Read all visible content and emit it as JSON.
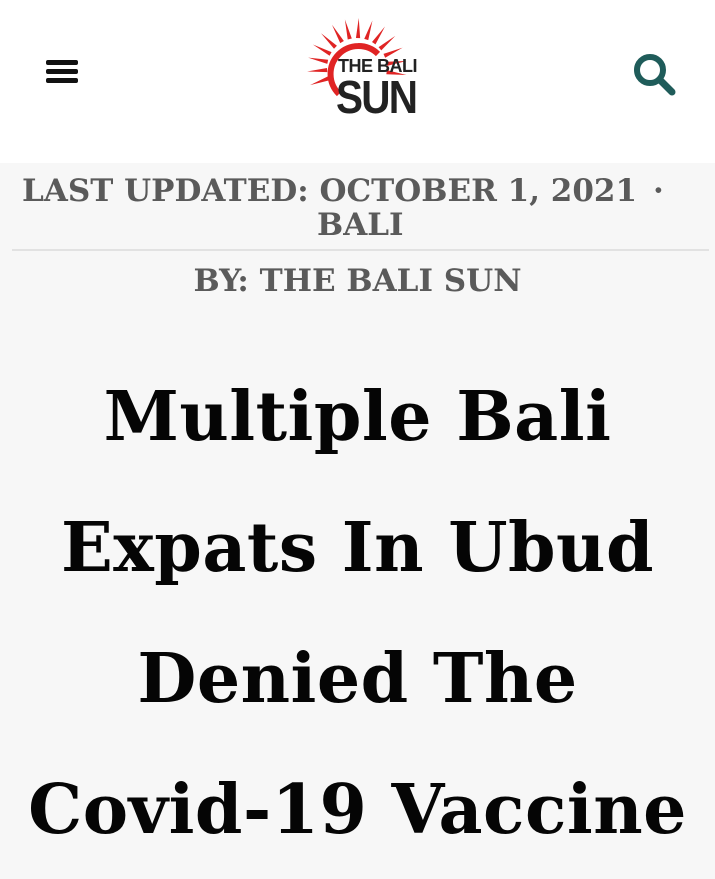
{
  "header": {
    "logo_line1": "THE BALI",
    "logo_line2": "SUN",
    "logo_color": "#e02424"
  },
  "icons": {
    "menu": "hamburger-menu-icon",
    "search": "magnifying-glass-icon",
    "search_color": "#1f5c5a"
  },
  "meta": {
    "updated": "LAST UPDATED: OCTOBER 1, 2021",
    "separator": "·",
    "category": "BALI"
  },
  "byline": "BY: THE BALI SUN",
  "article": {
    "title_lines": [
      "Multiple Bali",
      "Expats In Ubud",
      "Denied The",
      "Covid-19 Vaccine"
    ]
  }
}
